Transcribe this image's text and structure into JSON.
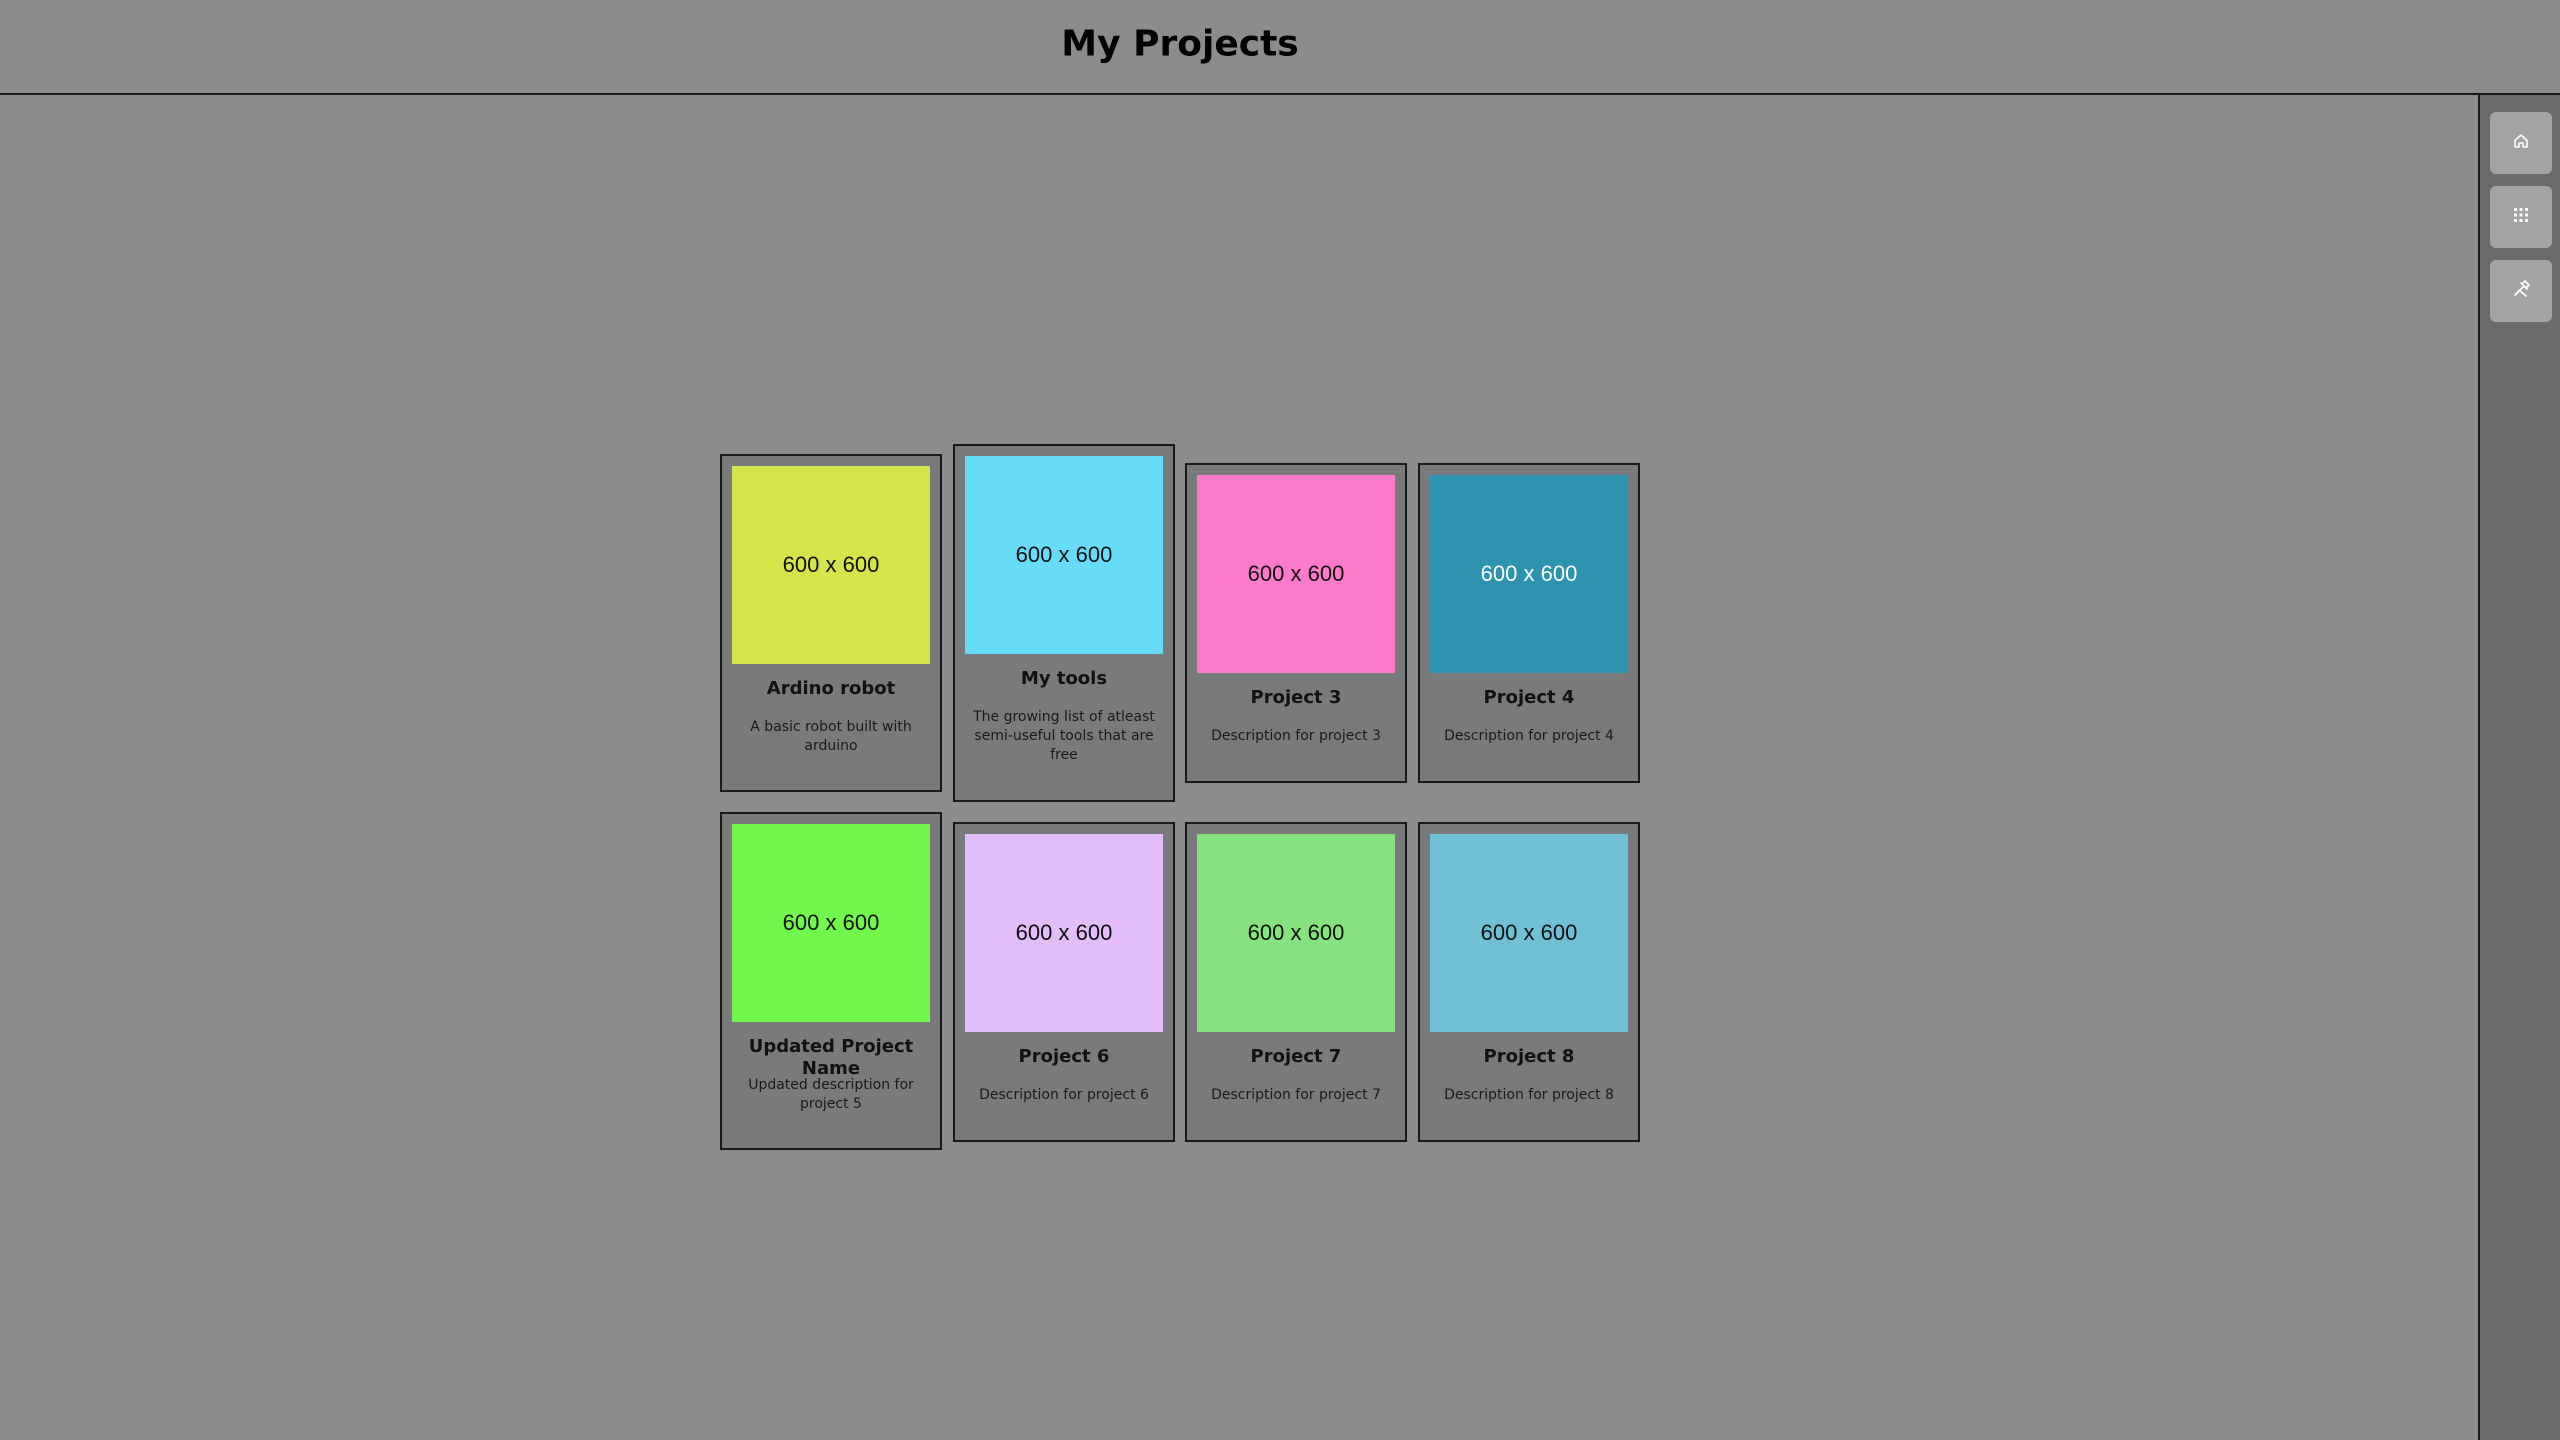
{
  "header": {
    "title": "My Projects"
  },
  "sidebar": {
    "buttons": [
      {
        "icon": "home-icon"
      },
      {
        "icon": "grid-icon"
      },
      {
        "icon": "tools-icon"
      }
    ]
  },
  "projects": [
    {
      "thumb_label": "600 x 600",
      "thumb_color": "#d5e44a",
      "thumb_text_color": "#111111",
      "title": "Ardino robot",
      "description": "A basic robot built with arduino"
    },
    {
      "thumb_label": "600 x 600",
      "thumb_color": "#67dcf7",
      "thumb_text_color": "#111111",
      "title": "My tools",
      "description": "The growing list of atleast semi-useful tools that are free"
    },
    {
      "thumb_label": "600 x 600",
      "thumb_color": "#fd7bca",
      "thumb_text_color": "#111111",
      "title": "Project 3",
      "description": "Description for project 3"
    },
    {
      "thumb_label": "600 x 600",
      "thumb_color": "#2d93ae",
      "thumb_text_color": "#ffffff",
      "title": "Project 4",
      "description": "Description for project 4"
    },
    {
      "thumb_label": "600 x 600",
      "thumb_color": "#72f74c",
      "thumb_text_color": "#111111",
      "title": "Updated Project Name",
      "description": "Updated description for project 5"
    },
    {
      "thumb_label": "600 x 600",
      "thumb_color": "#e2bdf7",
      "thumb_text_color": "#111111",
      "title": "Project 6",
      "description": "Description for project 6"
    },
    {
      "thumb_label": "600 x 600",
      "thumb_color": "#86e27f",
      "thumb_text_color": "#111111",
      "title": "Project 7",
      "description": "Description for project 7"
    },
    {
      "thumb_label": "600 x 600",
      "thumb_color": "#6ec0d2",
      "thumb_text_color": "#111111",
      "title": "Project 8",
      "description": "Description for project 8"
    }
  ]
}
